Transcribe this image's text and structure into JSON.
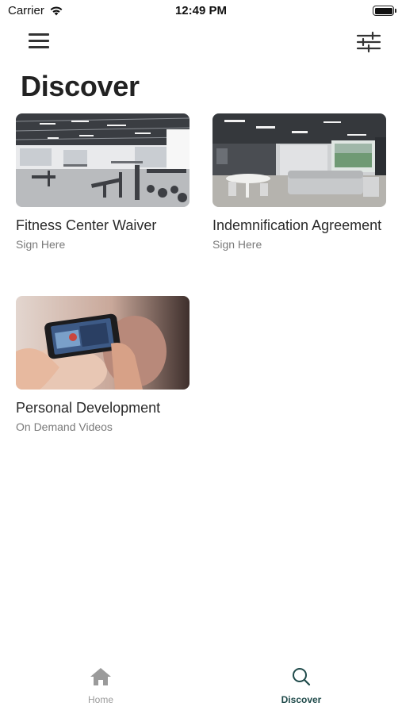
{
  "status_bar": {
    "carrier": "Carrier",
    "time": "12:49 PM"
  },
  "header": {
    "title": "Discover",
    "menu_icon": "hamburger-menu-icon",
    "filter_icon": "sliders-icon"
  },
  "cards": [
    {
      "title": "Fitness Center Waiver",
      "subtitle": "Sign Here",
      "image": "gym-photo"
    },
    {
      "title": "Indemnification Agreement",
      "subtitle": "Sign Here",
      "image": "lounge-photo"
    },
    {
      "title": "Personal Development",
      "subtitle": "On Demand Videos",
      "image": "phone-video-photo"
    }
  ],
  "tab_bar": {
    "tabs": [
      {
        "label": "Home",
        "icon": "home-icon",
        "active": false
      },
      {
        "label": "Discover",
        "icon": "search-icon",
        "active": true
      }
    ]
  },
  "colors": {
    "active_tab": "#1f4a4a",
    "inactive_tab": "#9a9a9a",
    "text": "#222222",
    "subtitle": "#7a7a7a"
  }
}
